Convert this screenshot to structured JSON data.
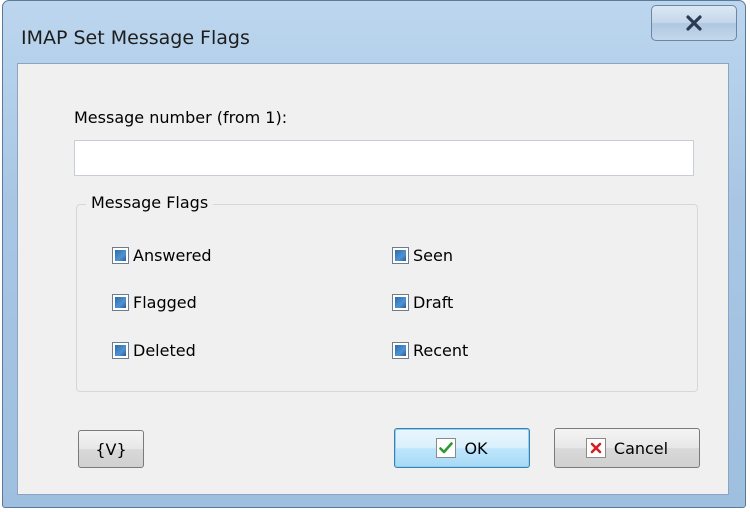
{
  "window": {
    "title": "IMAP Set Message Flags",
    "close_glyph": "✕"
  },
  "form": {
    "message_number_label": "Message number (from 1):",
    "message_number_value": "",
    "group_caption": "Message Flags",
    "flags": [
      {
        "label": "Answered",
        "checked": true
      },
      {
        "label": "Flagged",
        "checked": true
      },
      {
        "label": "Deleted",
        "checked": true
      },
      {
        "label": "Seen",
        "checked": true
      },
      {
        "label": "Draft",
        "checked": true
      },
      {
        "label": "Recent",
        "checked": true
      }
    ]
  },
  "buttons": {
    "variables_label": "{V}",
    "ok_label": "OK",
    "cancel_label": "Cancel"
  },
  "colors": {
    "checkbox_fill": "#3b7ec0",
    "ok_check": "#2e9a2e",
    "cancel_x": "#d32020",
    "close_x": "#2a3b52"
  }
}
